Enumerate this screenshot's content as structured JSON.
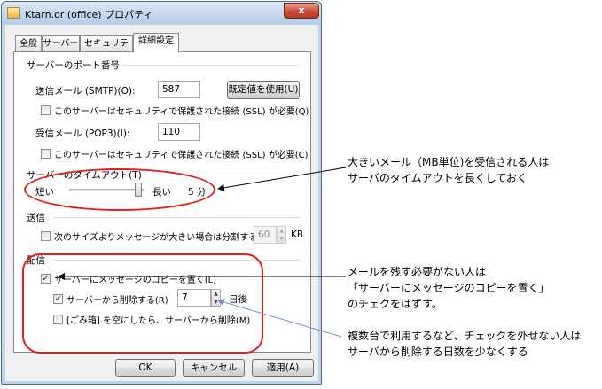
{
  "window": {
    "title": "Ktarn.or (office) プロパティ",
    "close_label": "x"
  },
  "tabs": [
    {
      "label": "全般",
      "active": false
    },
    {
      "label": "サーバー",
      "active": false
    },
    {
      "label": "セキュリティ",
      "active": false
    },
    {
      "label": "詳細設定",
      "active": true
    }
  ],
  "ports": {
    "group_label": "サーバーのポート番号",
    "smtp_label": "送信メール (SMTP)(O):",
    "smtp_value": "587",
    "default_button": "既定値を使用(U)",
    "smtp_ssl_label": "このサーバーはセキュリティで保護された接続 (SSL) が必要(Q)",
    "smtp_ssl_checked": false,
    "pop3_label": "受信メール (POP3)(I):",
    "pop3_value": "110",
    "pop3_ssl_label": "このサーバーはセキュリティで保護された接続 (SSL) が必要(C)",
    "pop3_ssl_checked": false
  },
  "timeout": {
    "group_label": "サーバーのタイムアウト(T)",
    "short_label": "短い",
    "long_label": "長い",
    "value_text": "5 分",
    "slider_position": 1.0
  },
  "sending": {
    "group_label": "送信",
    "split_label": "次のサイズよりメッセージが大きい場合は分割する(B)",
    "split_checked": false,
    "split_value": "60",
    "unit": "KB"
  },
  "delivery": {
    "group_label": "配信",
    "leave_copy_label": "サーバーにメッセージのコピーを置く(L)",
    "leave_copy_checked": true,
    "remove_after_label": "サーバーから削除する(R)",
    "remove_after_checked": true,
    "days_value": "7",
    "days_unit": "日後",
    "remove_on_trash_label": "[ごみ箱] を空にしたら、サーバーから削除(M)",
    "remove_on_trash_checked": false
  },
  "footer": {
    "ok": "OK",
    "cancel": "キャンセル",
    "apply": "適用(A)"
  },
  "annotations": {
    "timeout_note_line1": "大きいメール（MB単位)を受信される人は",
    "timeout_note_line2": "サーバのタイムアウトを長くしておく",
    "copy_note_line1": "メールを残す必要がない人は",
    "copy_note_line2": "「サーバーにメッセージのコピーを置く」",
    "copy_note_line3": "のチェクをはずす。",
    "days_note_line1": "複数台で利用するなど、チェックを外せない人は",
    "days_note_line2": "サーバから削除する日数を少なくする"
  },
  "colors": {
    "highlight_red": "#e3201b",
    "arrow_black": "#000000",
    "arrow_blue": "#6f8fc8"
  }
}
